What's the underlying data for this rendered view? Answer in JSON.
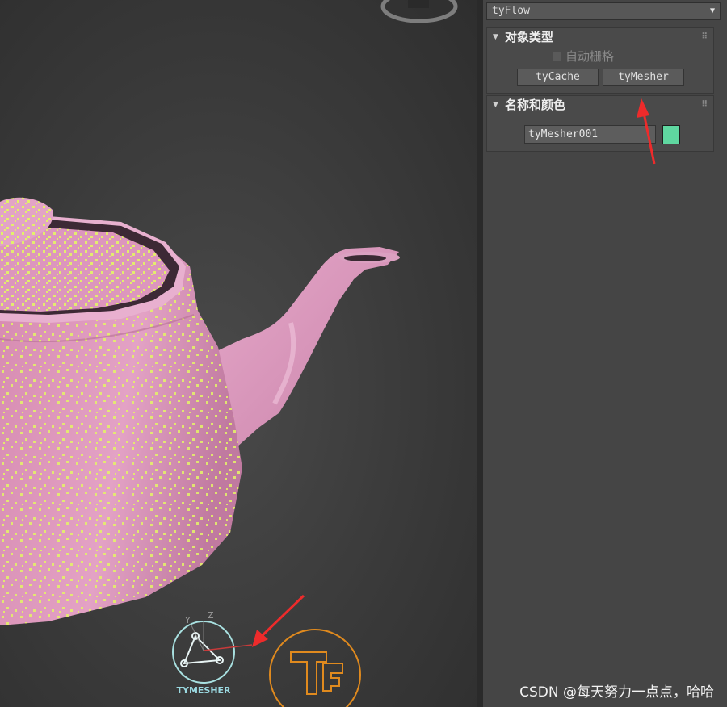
{
  "panel": {
    "dropdown_value": "tyFlow",
    "rollout_object_type": {
      "title": "对象类型",
      "autogrid_label": "自动栅格",
      "buttons": [
        "tyCache",
        "tyMesher"
      ]
    },
    "rollout_name_color": {
      "title": "名称和颜色",
      "name_value": "tyMesher001",
      "color": "#5fd7a0"
    }
  },
  "viewport": {
    "gizmo_label": "TYMESHER",
    "gizmo_axis_y": "Y",
    "gizmo_axis_z": "Z"
  },
  "watermark": "CSDN @每天努力一点点，哈哈"
}
